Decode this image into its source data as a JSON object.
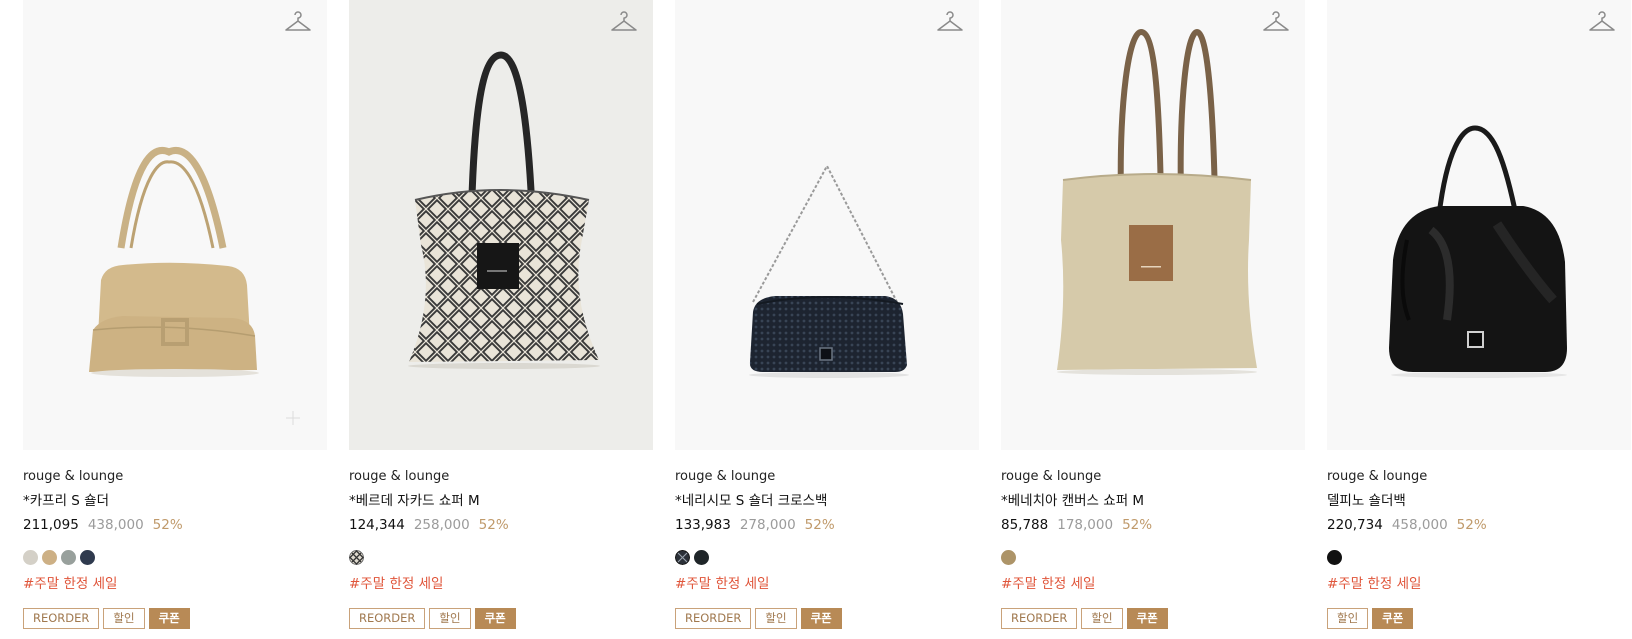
{
  "products": [
    {
      "brand": "rouge & lounge",
      "name": "*카프리 S 숄더",
      "price": "211,095",
      "original_price": "438,000",
      "discount": "52%",
      "colors": [
        "#d4d0c7",
        "#cdb085",
        "#98a09c",
        "#2f3a4e"
      ],
      "promo": "#주말 한정 세일",
      "tags": [
        "REORDER",
        "할인",
        "쿠폰"
      ],
      "image": "beige shoulder bag",
      "icon": "hanger-icon"
    },
    {
      "brand": "rouge & lounge",
      "name": "*베르데 자카드 쇼퍼 M",
      "price": "124,344",
      "original_price": "258,000",
      "discount": "52%",
      "colors": [
        "pattern"
      ],
      "promo": "#주말 한정 세일",
      "tags": [
        "REORDER",
        "할인",
        "쿠폰"
      ],
      "image": "jacquard shopper bag",
      "icon": "hanger-icon"
    },
    {
      "brand": "rouge & lounge",
      "name": "*네리시모 S 숄더 크로스백",
      "price": "133,983",
      "original_price": "278,000",
      "discount": "52%",
      "colors": [
        "pattern",
        "#1f2529"
      ],
      "promo": "#주말 한정 세일",
      "tags": [
        "REORDER",
        "할인",
        "쿠폰"
      ],
      "image": "navy woven chain bag",
      "icon": "hanger-icon"
    },
    {
      "brand": "rouge & lounge",
      "name": "*베네치아 캔버스 쇼퍼 M",
      "price": "85,788",
      "original_price": "178,000",
      "discount": "52%",
      "colors": [
        "#ad9468"
      ],
      "promo": "#주말 한정 세일",
      "tags": [
        "REORDER",
        "할인",
        "쿠폰"
      ],
      "image": "canvas shopper bag",
      "icon": "hanger-icon"
    },
    {
      "brand": "rouge & lounge",
      "name": "델피노 숄더백",
      "price": "220,734",
      "original_price": "458,000",
      "discount": "52%",
      "colors": [
        "#111111"
      ],
      "promo": "#주말 한정 세일",
      "tags": [
        "할인",
        "쿠폰"
      ],
      "image": "black leather hobo bag",
      "icon": "hanger-icon"
    }
  ]
}
